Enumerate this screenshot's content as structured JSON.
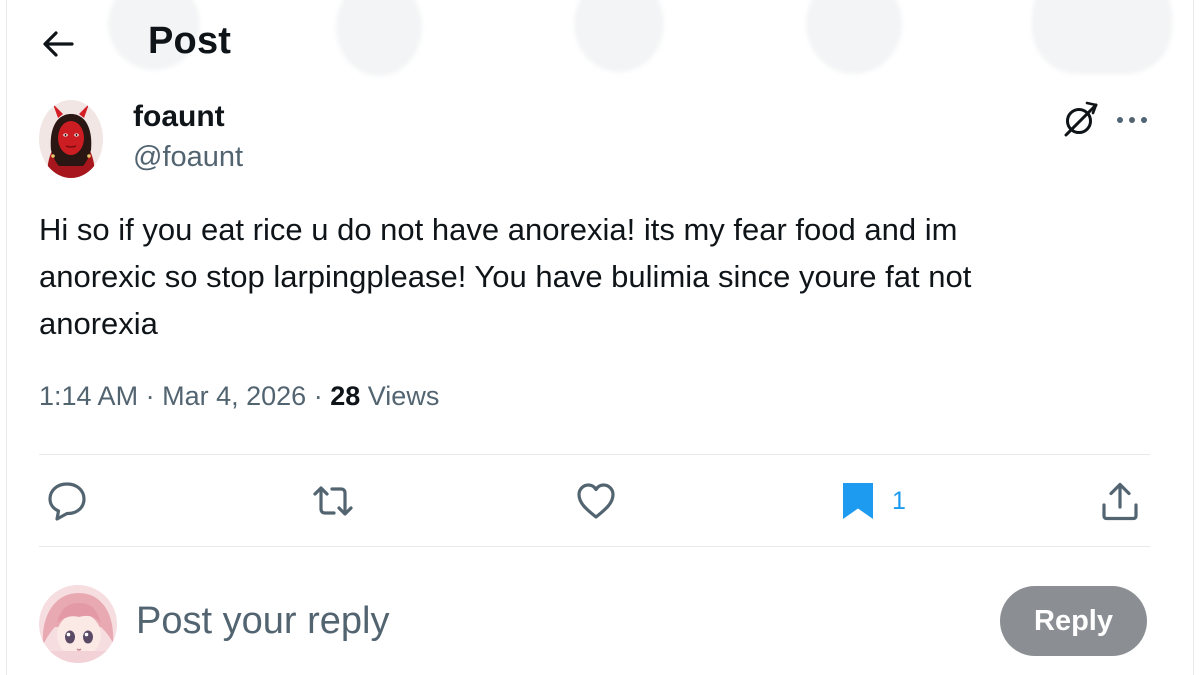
{
  "header": {
    "title": "Post",
    "back_icon": "arrow-left-icon"
  },
  "post": {
    "author": {
      "display_name": "foaunt",
      "handle": "@foaunt",
      "avatar_icon": "profile-photo-red-devil"
    },
    "text": "Hi so if you eat rice u do not have anorexia! its my fear food and im\nanorexic so stop larpingplease! You have bulimia since youre fat not\nanorexia",
    "time": "1:14 AM",
    "date": "Mar 4, 2026",
    "separator": "·",
    "views_count": "28",
    "views_label": "Views"
  },
  "actions": {
    "reply_icon": "speech-bubble-icon",
    "repost_icon": "repost-icon",
    "like_icon": "heart-icon",
    "bookmark_icon": "bookmark-filled-icon",
    "bookmark_count": "1",
    "share_icon": "share-upload-icon"
  },
  "composer": {
    "placeholder": "Post your reply",
    "reply_button_label": "Reply",
    "avatar_icon": "anime-avatar-pink-hair"
  },
  "colors": {
    "text_primary": "#0f1419",
    "text_secondary": "#536471",
    "accent_blue": "#1d9bf0",
    "divider": "#e7e9ea",
    "reply_button_disabled": "#8b8f93",
    "avatar_red": "#c0141c"
  }
}
